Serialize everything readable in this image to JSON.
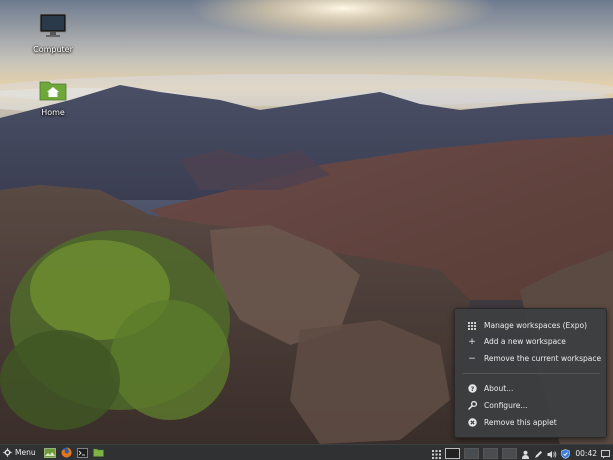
{
  "desktop": {
    "icons": [
      {
        "label": "Computer",
        "icon": "monitor-icon"
      },
      {
        "label": "Home",
        "icon": "home-folder-icon"
      }
    ]
  },
  "context_menu": {
    "items": [
      {
        "label": "Manage workspaces (Expo)",
        "icon": "grid-icon"
      },
      {
        "label": "Add a new workspace",
        "icon": "plus-icon"
      },
      {
        "label": "Remove the current workspace",
        "icon": "minus-icon"
      },
      {
        "label": "About...",
        "icon": "help-icon"
      },
      {
        "label": "Configure...",
        "icon": "wrench-icon"
      },
      {
        "label": "Remove this applet",
        "icon": "remove-icon"
      }
    ]
  },
  "panel": {
    "menu_label": "Menu",
    "launchers": [
      "show-desktop-icon",
      "firefox-icon",
      "terminal-icon",
      "files-icon"
    ],
    "workspaces": {
      "count": 4,
      "active": 1
    },
    "tray_icons": [
      "expo-grid-icon",
      "user-icon",
      "pen-icon",
      "volume-icon",
      "shield-icon"
    ],
    "clock": "00:42",
    "colors": {
      "panel_bg": "#2f3133",
      "menu_bg": "#3c3e40",
      "text": "#ececec"
    }
  }
}
